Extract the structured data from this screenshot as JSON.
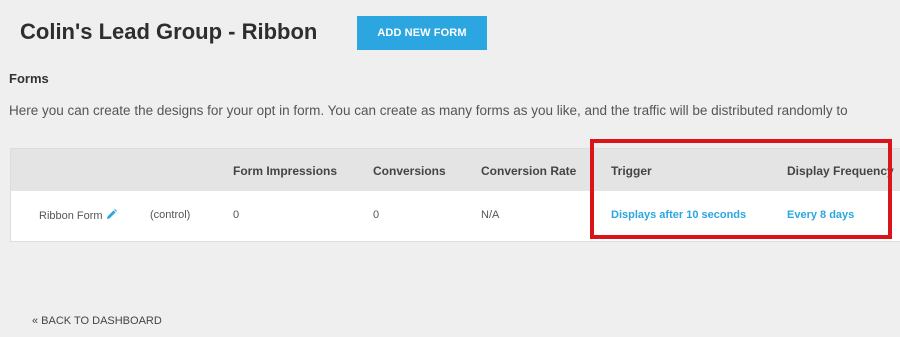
{
  "header": {
    "title": "Colin's Lead Group - Ribbon",
    "add_button_label": "ADD NEW FORM"
  },
  "forms_section": {
    "title": "Forms",
    "description": "Here you can create the designs for your opt in form. You can create as many forms as you like, and the traffic will be distributed randomly to"
  },
  "table": {
    "headers": {
      "impressions": "Form Impressions",
      "conversions": "Conversions",
      "conversion_rate": "Conversion Rate",
      "trigger": "Trigger",
      "display_frequency": "Display Frequency"
    },
    "rows": [
      {
        "name": "Ribbon Form",
        "variant": "(control)",
        "impressions": "0",
        "conversions": "0",
        "conversion_rate": "N/A",
        "trigger": "Displays after 10 seconds",
        "display_frequency": "Every 8 days"
      }
    ]
  },
  "footer": {
    "back_link": "« BACK TO DASHBOARD"
  },
  "colors": {
    "accent": "#2ba6e0",
    "highlight": "#d9141b",
    "background": "#efefef"
  },
  "icons": {
    "edit": "pencil-icon"
  }
}
